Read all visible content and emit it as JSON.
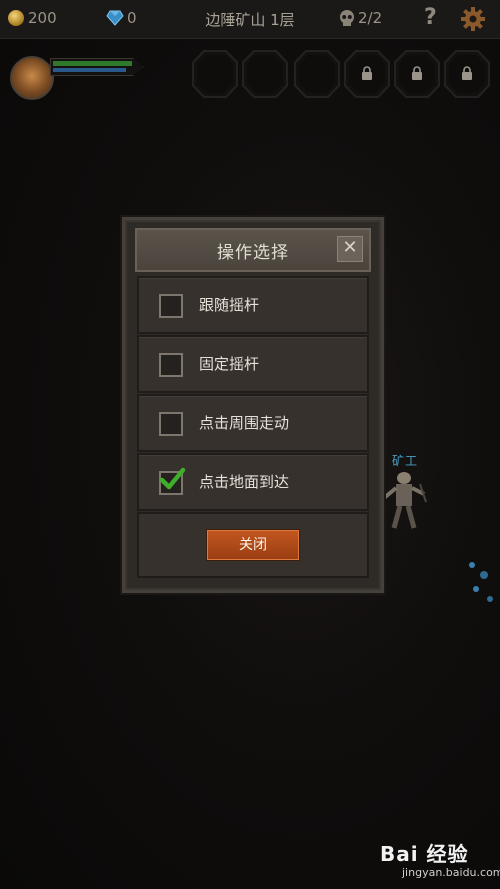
{
  "topbar": {
    "coins": "200",
    "gems": "0",
    "level_title": "边陲矿山 1层",
    "kills": "2/2",
    "help_label": "?"
  },
  "hero": {
    "hp_fraction": 0.92,
    "mp_fraction": 0.85
  },
  "skill_slots": [
    {
      "locked": false
    },
    {
      "locked": false
    },
    {
      "locked": false
    },
    {
      "locked": true
    },
    {
      "locked": true
    },
    {
      "locked": true
    }
  ],
  "npc": {
    "label": "矿工"
  },
  "dialog": {
    "title": "操作选择",
    "close_x": "✕",
    "options": [
      {
        "label": "跟随摇杆",
        "checked": false
      },
      {
        "label": "固定摇杆",
        "checked": false
      },
      {
        "label": "点击周围走动",
        "checked": false
      },
      {
        "label": "点击地面到达",
        "checked": true
      }
    ],
    "close_button": "关闭"
  },
  "watermark": {
    "logo": "Bai  经验",
    "url": "jingyan.baidu.com"
  },
  "colors": {
    "accent_orange": "#b34a19",
    "check_green": "#3fae2c",
    "npc_blue": "#4aa3c8"
  }
}
